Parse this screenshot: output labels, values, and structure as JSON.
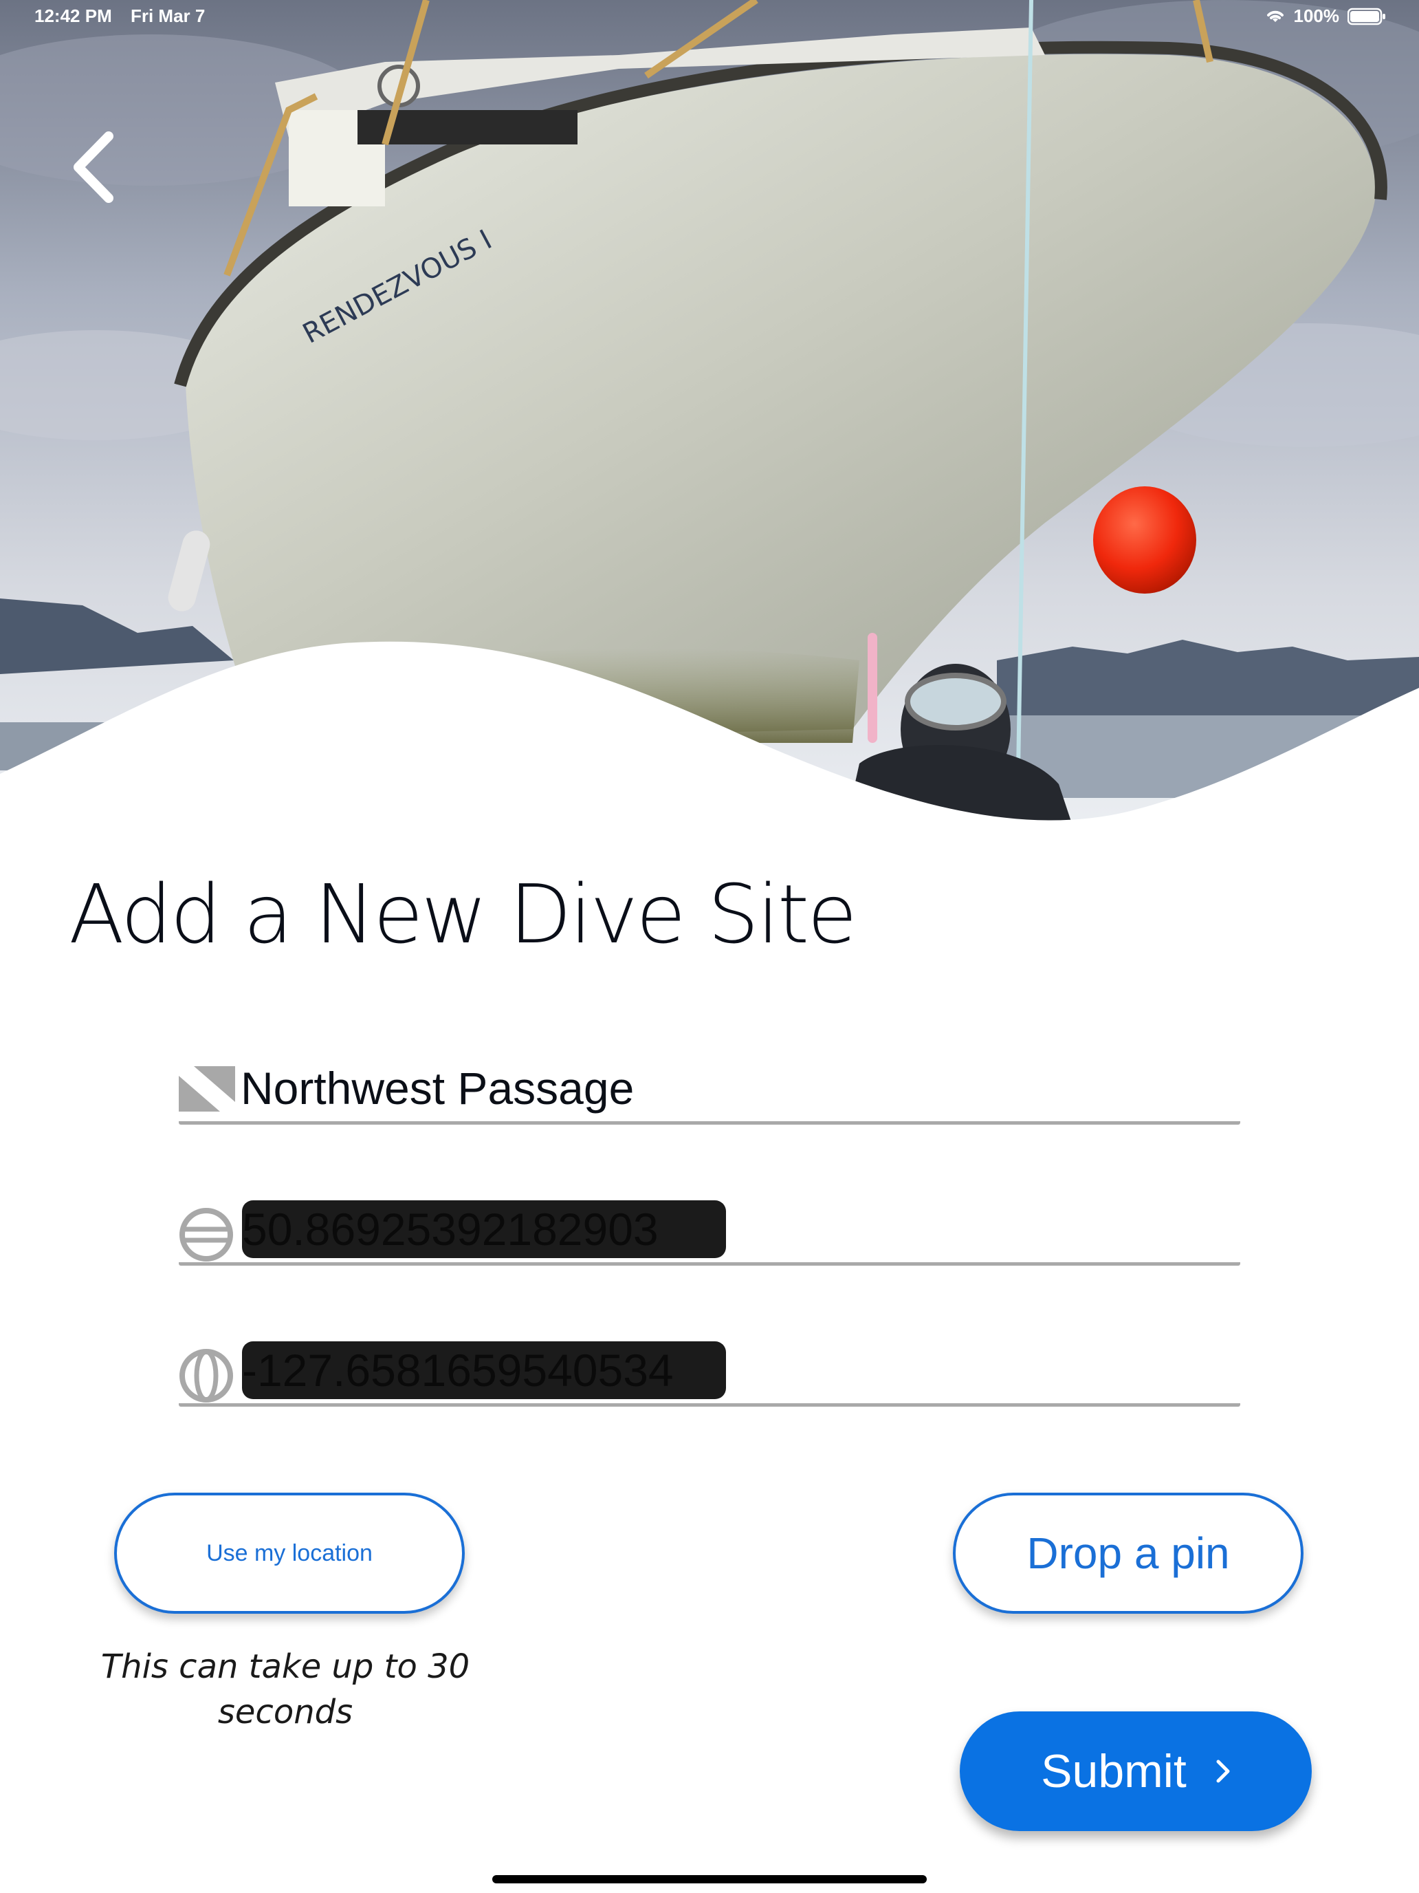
{
  "status_bar": {
    "time": "12:42 PM",
    "date": "Fri Mar 7",
    "battery_percent": "100%",
    "battery_level": 1.0,
    "icons": [
      "wifi-icon",
      "battery-icon"
    ]
  },
  "hero": {
    "image_description_icon": "boat-photo",
    "boat_name": "RENDEZVOUS I"
  },
  "nav": {
    "back_icon": "chevron-left-icon"
  },
  "title": "Add a New Dive Site",
  "form": {
    "name": {
      "icon": "dive-flag-icon",
      "value": "Northwest Passage"
    },
    "latitude": {
      "icon": "latitude-globe-icon",
      "value": "50.86925392182903"
    },
    "longitude": {
      "icon": "longitude-globe-icon",
      "value": "-127.6581659540534"
    }
  },
  "buttons": {
    "use_location": "Use my location",
    "drop_pin": "Drop a pin",
    "submit": "Submit"
  },
  "location_note": "This can take up to 30 seconds",
  "colors": {
    "accent": "#1a6fd6",
    "submit_bg": "#0a72e3",
    "field_underline": "#a9a9a9",
    "redaction": "#1b1b1b"
  }
}
